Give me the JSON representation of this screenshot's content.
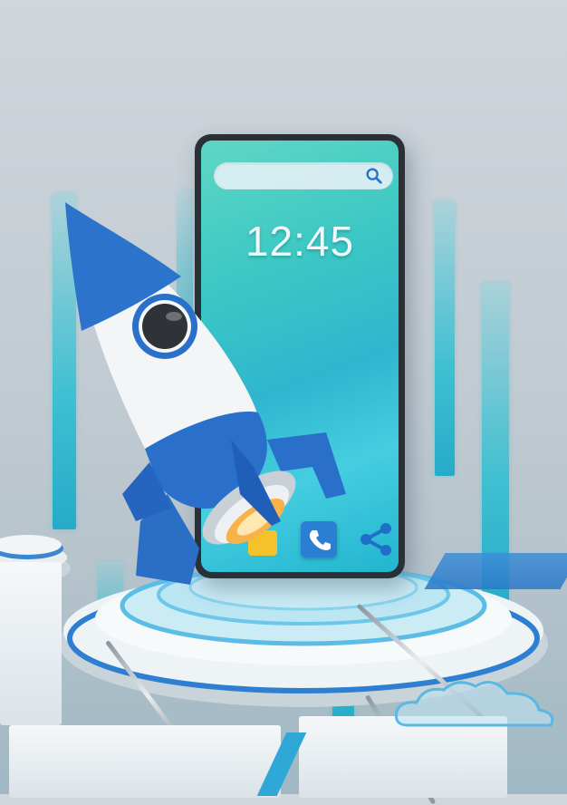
{
  "phone": {
    "time": "12:45"
  },
  "icons": {
    "search": "search-icon",
    "call": "phone-call-icon",
    "share": "share-icon",
    "rocket": "rocket-icon"
  },
  "colors": {
    "screen_teal": "#3cc8c4",
    "rocket_blue": "#2a6fc9",
    "rocket_white": "#f4f6f8",
    "accent_cyan": "#28bcd3"
  }
}
